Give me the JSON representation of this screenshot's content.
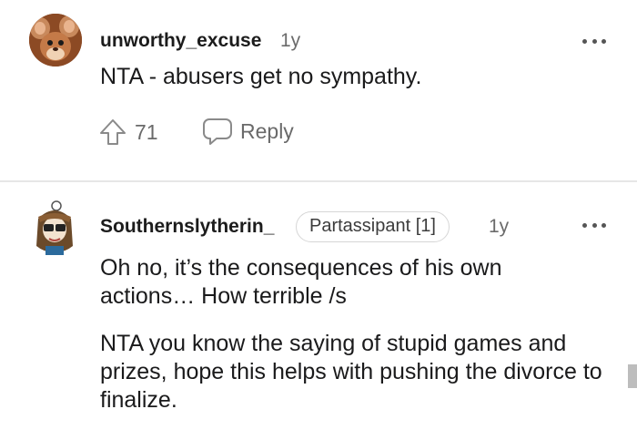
{
  "comments": [
    {
      "username": "unworthy_excuse",
      "age": "1y",
      "text": "NTA - abusers get no sympathy.",
      "upvotes": "71",
      "reply_label": "Reply"
    },
    {
      "username": "Southernslytherin_",
      "flair": "Partassipant [1]",
      "age": "1y",
      "paragraphs": [
        "Oh no, it’s the consequences of his own actions… How terrible /s",
        "NTA you know the saying of stupid games and prizes, hope this helps with pushing the divorce to finalize."
      ]
    }
  ],
  "icons": {
    "upvote": "arrow-up-icon",
    "reply": "speech-bubble-icon",
    "more": "more-options-icon"
  },
  "colors": {
    "text": "#1a1a1b",
    "muted": "#6b6b6b",
    "divider": "#e6e6e6"
  }
}
